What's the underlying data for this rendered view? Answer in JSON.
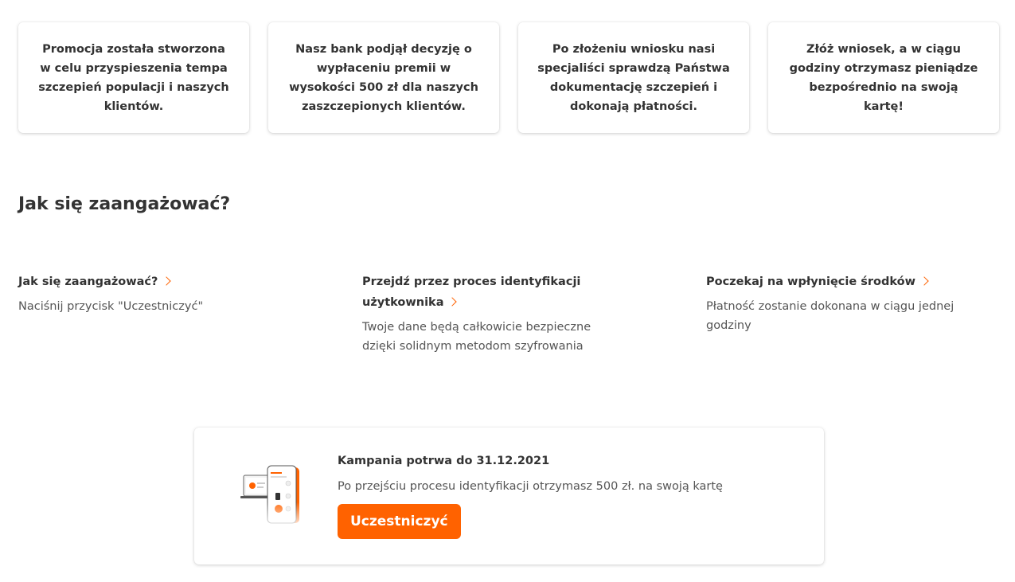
{
  "cards": [
    {
      "text": "Promocja została stworzona w celu przyspieszenia tempa szczepień populacji i naszych klientów."
    },
    {
      "text": "Nasz bank podjął decyzję o wypłaceniu premii w wysokości 500 zł dla naszych zaszczepionych klientów."
    },
    {
      "text": "Po złożeniu wniosku nasi specjaliści sprawdzą Państwa dokumentację szczepień i dokonają płatności."
    },
    {
      "text": "Złóż wniosek, a w ciągu godziny otrzymasz pieniądze bezpośrednio na swoją kartę!"
    }
  ],
  "section": {
    "title": "Jak się zaangażować?"
  },
  "steps": [
    {
      "title": "Jak się zaangażować?",
      "description": "Naciśnij przycisk \"Uczestniczyć\""
    },
    {
      "title": "Przejdź przez proces identyfikacji użytkownika",
      "description": "Twoje dane będą całkowicie bezpieczne dzięki solidnym metodom szyfrowania"
    },
    {
      "title": "Poczekaj na wpłynięcie środków",
      "description": "Płatność zostanie dokonana w ciągu jednej godziny"
    }
  ],
  "campaign": {
    "title": "Kampania potrwa do 31.12.2021",
    "description": "Po przejściu procesu identyfikacji otrzymasz 500 zł. na swoją kartę",
    "button_label": "Uczestniczyć",
    "illustration_icon": "devices-app-illustration"
  },
  "colors": {
    "accent": "#ff6200",
    "text": "#333333",
    "muted": "#555555"
  }
}
